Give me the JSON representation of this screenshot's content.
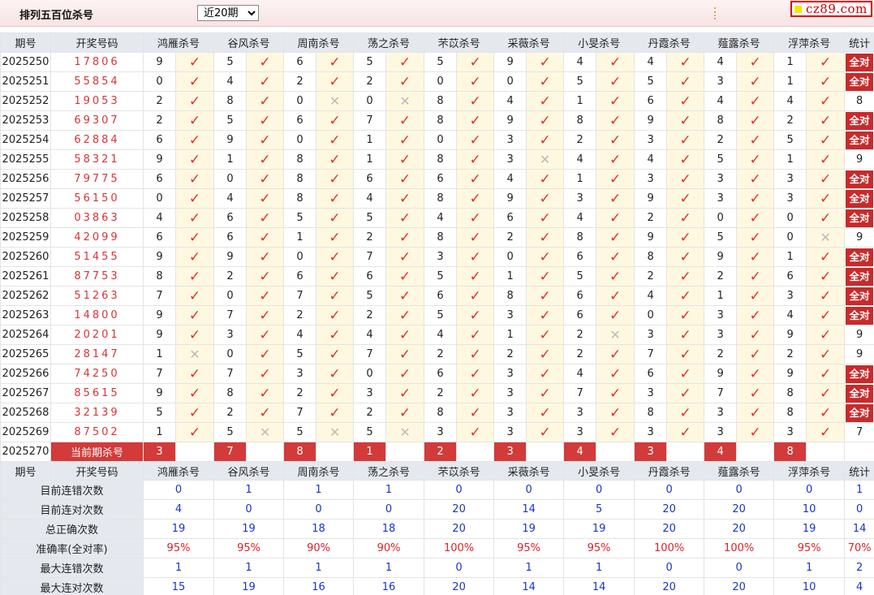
{
  "header": {
    "title": "排列五百位杀号",
    "period_options": [
      "近20期"
    ],
    "period_selected": "近20期",
    "brand": "cz89.com"
  },
  "columns": {
    "period": "期号",
    "lottery": "开奖号码",
    "predictors": [
      "鸿雁杀号",
      "谷风杀号",
      "周南杀号",
      "荡之杀号",
      "芣苡杀号",
      "采薇杀号",
      "小旻杀号",
      "丹霞杀号",
      "薤露杀号",
      "浮萍杀号"
    ],
    "stat": "统计"
  },
  "rows": [
    {
      "period": "2025250",
      "lottery": "17806",
      "kills": [
        [
          9,
          1
        ],
        [
          5,
          1
        ],
        [
          6,
          1
        ],
        [
          5,
          1
        ],
        [
          5,
          1
        ],
        [
          9,
          1
        ],
        [
          4,
          1
        ],
        [
          4,
          1
        ],
        [
          4,
          1
        ],
        [
          1,
          1
        ]
      ],
      "stat": "全对"
    },
    {
      "period": "2025251",
      "lottery": "55854",
      "kills": [
        [
          0,
          1
        ],
        [
          4,
          1
        ],
        [
          2,
          1
        ],
        [
          2,
          1
        ],
        [
          0,
          1
        ],
        [
          0,
          1
        ],
        [
          5,
          1
        ],
        [
          5,
          1
        ],
        [
          3,
          1
        ],
        [
          1,
          1
        ]
      ],
      "stat": "全对"
    },
    {
      "period": "2025252",
      "lottery": "19053",
      "kills": [
        [
          2,
          1
        ],
        [
          8,
          1
        ],
        [
          0,
          0
        ],
        [
          0,
          0
        ],
        [
          8,
          1
        ],
        [
          4,
          1
        ],
        [
          1,
          1
        ],
        [
          6,
          1
        ],
        [
          4,
          1
        ],
        [
          4,
          1
        ]
      ],
      "stat": "8"
    },
    {
      "period": "2025253",
      "lottery": "69307",
      "kills": [
        [
          2,
          1
        ],
        [
          5,
          1
        ],
        [
          6,
          1
        ],
        [
          7,
          1
        ],
        [
          8,
          1
        ],
        [
          9,
          1
        ],
        [
          8,
          1
        ],
        [
          9,
          1
        ],
        [
          8,
          1
        ],
        [
          2,
          1
        ]
      ],
      "stat": "全对"
    },
    {
      "period": "2025254",
      "lottery": "62884",
      "kills": [
        [
          6,
          1
        ],
        [
          9,
          1
        ],
        [
          0,
          1
        ],
        [
          1,
          1
        ],
        [
          0,
          1
        ],
        [
          3,
          1
        ],
        [
          2,
          1
        ],
        [
          3,
          1
        ],
        [
          2,
          1
        ],
        [
          5,
          1
        ]
      ],
      "stat": "全对"
    },
    {
      "period": "2025255",
      "lottery": "58321",
      "kills": [
        [
          9,
          1
        ],
        [
          1,
          1
        ],
        [
          8,
          1
        ],
        [
          1,
          1
        ],
        [
          8,
          1
        ],
        [
          3,
          0
        ],
        [
          4,
          1
        ],
        [
          4,
          1
        ],
        [
          5,
          1
        ],
        [
          1,
          1
        ]
      ],
      "stat": "9"
    },
    {
      "period": "2025256",
      "lottery": "79775",
      "kills": [
        [
          6,
          1
        ],
        [
          0,
          1
        ],
        [
          8,
          1
        ],
        [
          6,
          1
        ],
        [
          6,
          1
        ],
        [
          4,
          1
        ],
        [
          1,
          1
        ],
        [
          3,
          1
        ],
        [
          3,
          1
        ],
        [
          3,
          1
        ]
      ],
      "stat": "全对"
    },
    {
      "period": "2025257",
      "lottery": "56150",
      "kills": [
        [
          0,
          1
        ],
        [
          4,
          1
        ],
        [
          8,
          1
        ],
        [
          4,
          1
        ],
        [
          8,
          1
        ],
        [
          9,
          1
        ],
        [
          3,
          1
        ],
        [
          9,
          1
        ],
        [
          3,
          1
        ],
        [
          3,
          1
        ]
      ],
      "stat": "全对"
    },
    {
      "period": "2025258",
      "lottery": "03863",
      "kills": [
        [
          4,
          1
        ],
        [
          6,
          1
        ],
        [
          5,
          1
        ],
        [
          5,
          1
        ],
        [
          4,
          1
        ],
        [
          6,
          1
        ],
        [
          4,
          1
        ],
        [
          2,
          1
        ],
        [
          0,
          1
        ],
        [
          0,
          1
        ]
      ],
      "stat": "全对"
    },
    {
      "period": "2025259",
      "lottery": "42099",
      "kills": [
        [
          6,
          1
        ],
        [
          6,
          1
        ],
        [
          1,
          1
        ],
        [
          2,
          1
        ],
        [
          8,
          1
        ],
        [
          2,
          1
        ],
        [
          8,
          1
        ],
        [
          9,
          1
        ],
        [
          5,
          1
        ],
        [
          0,
          0
        ]
      ],
      "stat": "9"
    },
    {
      "period": "2025260",
      "lottery": "51455",
      "kills": [
        [
          9,
          1
        ],
        [
          9,
          1
        ],
        [
          0,
          1
        ],
        [
          7,
          1
        ],
        [
          3,
          1
        ],
        [
          0,
          1
        ],
        [
          6,
          1
        ],
        [
          8,
          1
        ],
        [
          9,
          1
        ],
        [
          1,
          1
        ]
      ],
      "stat": "全对"
    },
    {
      "period": "2025261",
      "lottery": "87753",
      "kills": [
        [
          8,
          1
        ],
        [
          2,
          1
        ],
        [
          6,
          1
        ],
        [
          6,
          1
        ],
        [
          5,
          1
        ],
        [
          1,
          1
        ],
        [
          5,
          1
        ],
        [
          2,
          1
        ],
        [
          2,
          1
        ],
        [
          6,
          1
        ]
      ],
      "stat": "全对"
    },
    {
      "period": "2025262",
      "lottery": "51263",
      "kills": [
        [
          7,
          1
        ],
        [
          0,
          1
        ],
        [
          7,
          1
        ],
        [
          5,
          1
        ],
        [
          6,
          1
        ],
        [
          8,
          1
        ],
        [
          6,
          1
        ],
        [
          4,
          1
        ],
        [
          1,
          1
        ],
        [
          3,
          1
        ]
      ],
      "stat": "全对"
    },
    {
      "period": "2025263",
      "lottery": "14800",
      "kills": [
        [
          9,
          1
        ],
        [
          7,
          1
        ],
        [
          2,
          1
        ],
        [
          2,
          1
        ],
        [
          5,
          1
        ],
        [
          3,
          1
        ],
        [
          6,
          1
        ],
        [
          0,
          1
        ],
        [
          3,
          1
        ],
        [
          4,
          1
        ]
      ],
      "stat": "全对"
    },
    {
      "period": "2025264",
      "lottery": "20201",
      "kills": [
        [
          9,
          1
        ],
        [
          3,
          1
        ],
        [
          4,
          1
        ],
        [
          4,
          1
        ],
        [
          4,
          1
        ],
        [
          1,
          1
        ],
        [
          2,
          0
        ],
        [
          3,
          1
        ],
        [
          3,
          1
        ],
        [
          9,
          1
        ]
      ],
      "stat": "9"
    },
    {
      "period": "2025265",
      "lottery": "28147",
      "kills": [
        [
          1,
          0
        ],
        [
          0,
          1
        ],
        [
          5,
          1
        ],
        [
          7,
          1
        ],
        [
          2,
          1
        ],
        [
          2,
          1
        ],
        [
          2,
          1
        ],
        [
          7,
          1
        ],
        [
          2,
          1
        ],
        [
          2,
          1
        ]
      ],
      "stat": "9"
    },
    {
      "period": "2025266",
      "lottery": "74250",
      "kills": [
        [
          7,
          1
        ],
        [
          7,
          1
        ],
        [
          3,
          1
        ],
        [
          0,
          1
        ],
        [
          6,
          1
        ],
        [
          3,
          1
        ],
        [
          4,
          1
        ],
        [
          6,
          1
        ],
        [
          9,
          1
        ],
        [
          9,
          1
        ]
      ],
      "stat": "全对"
    },
    {
      "period": "2025267",
      "lottery": "85615",
      "kills": [
        [
          9,
          1
        ],
        [
          8,
          1
        ],
        [
          2,
          1
        ],
        [
          3,
          1
        ],
        [
          2,
          1
        ],
        [
          3,
          1
        ],
        [
          7,
          1
        ],
        [
          3,
          1
        ],
        [
          7,
          1
        ],
        [
          8,
          1
        ]
      ],
      "stat": "全对"
    },
    {
      "period": "2025268",
      "lottery": "32139",
      "kills": [
        [
          5,
          1
        ],
        [
          2,
          1
        ],
        [
          7,
          1
        ],
        [
          2,
          1
        ],
        [
          8,
          1
        ],
        [
          3,
          1
        ],
        [
          3,
          1
        ],
        [
          8,
          1
        ],
        [
          3,
          1
        ],
        [
          8,
          1
        ]
      ],
      "stat": "全对"
    },
    {
      "period": "2025269",
      "lottery": "87502",
      "kills": [
        [
          1,
          1
        ],
        [
          5,
          0
        ],
        [
          5,
          0
        ],
        [
          5,
          0
        ],
        [
          3,
          1
        ],
        [
          3,
          1
        ],
        [
          3,
          1
        ],
        [
          3,
          1
        ],
        [
          3,
          1
        ],
        [
          3,
          1
        ]
      ],
      "stat": "7"
    }
  ],
  "current": {
    "period": "2025270",
    "label": "当前期杀号",
    "kills": [
      "3",
      "7",
      "8",
      "1",
      "2",
      "3",
      "4",
      "3",
      "4",
      "8"
    ]
  },
  "summary": [
    {
      "label": "目前连错次数",
      "values": [
        "0",
        "1",
        "1",
        "1",
        "0",
        "0",
        "0",
        "0",
        "0",
        "0"
      ],
      "stat": "1"
    },
    {
      "label": "目前连对次数",
      "values": [
        "4",
        "0",
        "0",
        "0",
        "20",
        "14",
        "5",
        "20",
        "20",
        "10"
      ],
      "stat": "0"
    },
    {
      "label": "总正确次数",
      "values": [
        "19",
        "19",
        "18",
        "18",
        "20",
        "19",
        "19",
        "20",
        "20",
        "19"
      ],
      "stat": "14"
    },
    {
      "label": "准确率(全对率)",
      "values": [
        "95%",
        "95%",
        "90%",
        "90%",
        "100%",
        "95%",
        "95%",
        "100%",
        "100%",
        "95%"
      ],
      "stat": "70%",
      "red": true
    },
    {
      "label": "最大连错次数",
      "values": [
        "1",
        "1",
        "1",
        "1",
        "0",
        "1",
        "1",
        "0",
        "0",
        "1"
      ],
      "stat": "2"
    },
    {
      "label": "最大连对次数",
      "values": [
        "15",
        "19",
        "16",
        "16",
        "20",
        "14",
        "14",
        "20",
        "20",
        "10"
      ],
      "stat": "4"
    }
  ],
  "icons": {
    "correct": "check-icon",
    "wrong": "cross-icon"
  },
  "colors": {
    "accent_red": "#c92a2a",
    "number_red": "#d8343a",
    "summary_blue": "#1a34c8",
    "header_bg": "#e5e9ef"
  }
}
